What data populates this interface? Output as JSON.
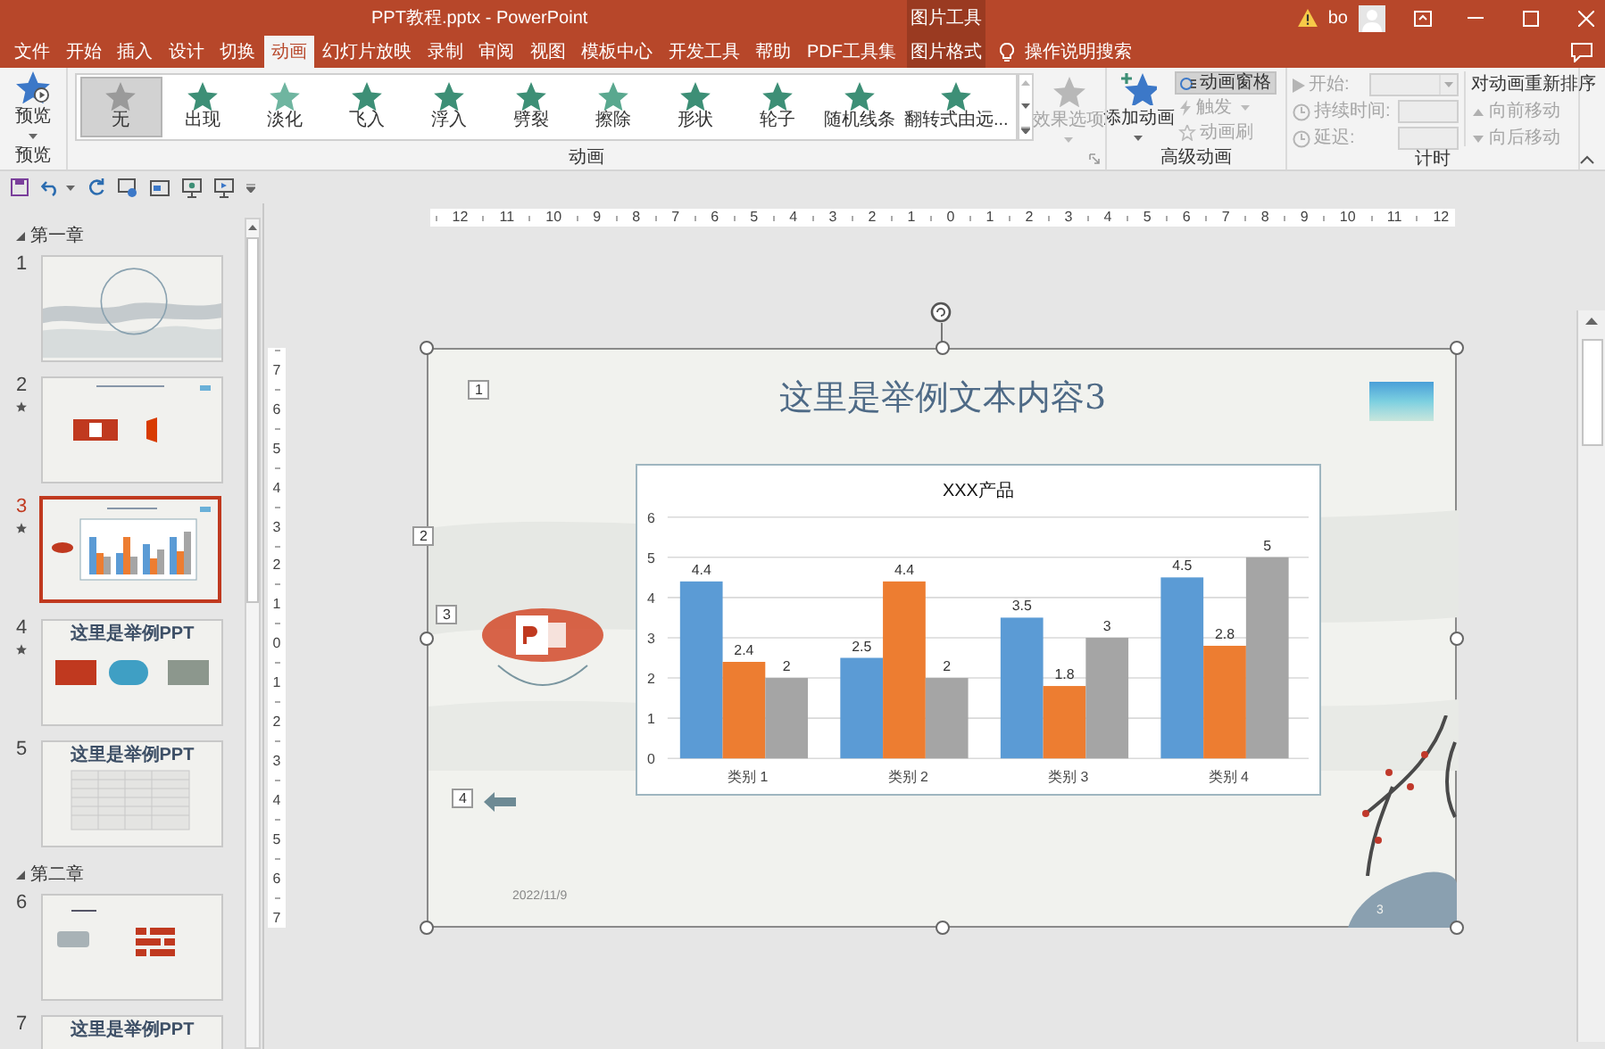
{
  "window": {
    "title": "PPT教程.pptx  -  PowerPoint",
    "context_label": "图片工具",
    "user": "bo"
  },
  "tabs": [
    {
      "label": "文件",
      "selected": false,
      "kind": "plain"
    },
    {
      "label": "开始",
      "selected": false,
      "kind": "plain"
    },
    {
      "label": "插入",
      "selected": false,
      "kind": "plain"
    },
    {
      "label": "设计",
      "selected": false,
      "kind": "plain"
    },
    {
      "label": "切换",
      "selected": false,
      "kind": "plain"
    },
    {
      "label": "动画",
      "selected": true,
      "kind": "plain"
    },
    {
      "label": "幻灯片放映",
      "selected": false,
      "kind": "plain"
    },
    {
      "label": "录制",
      "selected": false,
      "kind": "plain"
    },
    {
      "label": "审阅",
      "selected": false,
      "kind": "plain"
    },
    {
      "label": "视图",
      "selected": false,
      "kind": "plain"
    },
    {
      "label": "模板中心",
      "selected": false,
      "kind": "plain"
    },
    {
      "label": "开发工具",
      "selected": false,
      "kind": "plain"
    },
    {
      "label": "帮助",
      "selected": false,
      "kind": "plain"
    },
    {
      "label": "PDF工具集",
      "selected": false,
      "kind": "plain"
    },
    {
      "label": "图片格式",
      "selected": false,
      "kind": "contextual"
    }
  ],
  "search": {
    "placeholder": "操作说明搜索"
  },
  "ribbon": {
    "preview": {
      "label": "预览",
      "group": "预览"
    },
    "gallery": {
      "group": "动画",
      "items": [
        {
          "label": "无",
          "selected": true
        },
        {
          "label": "出现",
          "selected": false
        },
        {
          "label": "淡化",
          "selected": false
        },
        {
          "label": "飞入",
          "selected": false
        },
        {
          "label": "浮入",
          "selected": false
        },
        {
          "label": "劈裂",
          "selected": false
        },
        {
          "label": "擦除",
          "selected": false
        },
        {
          "label": "形状",
          "selected": false
        },
        {
          "label": "轮子",
          "selected": false
        },
        {
          "label": "随机线条",
          "selected": false
        },
        {
          "label": "翻转式由远...",
          "selected": false
        }
      ]
    },
    "effect_options": {
      "label": "效果选项",
      "disabled": true
    },
    "advanced": {
      "group": "高级动画",
      "add": "添加动画",
      "pane": {
        "label": "动画窗格",
        "on": true
      },
      "trigger": {
        "label": "触发",
        "disabled": true
      },
      "painter": {
        "label": "动画刷",
        "disabled": true
      }
    },
    "timing": {
      "group": "计时",
      "fields": [
        {
          "label": "开始:",
          "kind": "dropdown",
          "disabled": true
        },
        {
          "label": "持续时间:",
          "kind": "spin",
          "disabled": true
        },
        {
          "label": "延迟:",
          "kind": "spin",
          "disabled": true
        }
      ],
      "reorder": {
        "title": "对动画重新排序",
        "buttons": [
          {
            "label": "向前移动",
            "disabled": true
          },
          {
            "label": "向后移动",
            "disabled": true
          }
        ]
      }
    }
  },
  "slides_panel": {
    "sections": [
      {
        "title": "第一章",
        "expanded": true,
        "slides": [
          {
            "number": "1",
            "selected": false,
            "animated": false,
            "kind": "cover"
          },
          {
            "number": "2",
            "selected": false,
            "animated": true,
            "kind": "logos"
          },
          {
            "number": "3",
            "selected": true,
            "animated": true,
            "kind": "chart"
          },
          {
            "number": "4",
            "selected": false,
            "animated": true,
            "kind": "images",
            "title": "这里是举例PPT"
          },
          {
            "number": "5",
            "selected": false,
            "animated": false,
            "kind": "table",
            "title": "这里是举例PPT"
          }
        ]
      },
      {
        "title": "第二章",
        "expanded": true,
        "slides": [
          {
            "number": "6",
            "selected": false,
            "animated": false,
            "kind": "tiles"
          },
          {
            "number": "7",
            "selected": false,
            "animated": false,
            "kind": "title",
            "title": "这里是举例PPT"
          }
        ]
      }
    ]
  },
  "rulers": {
    "horizontal": [
      "12",
      "11",
      "10",
      "9",
      "8",
      "7",
      "6",
      "5",
      "4",
      "3",
      "2",
      "1",
      "0",
      "1",
      "2",
      "3",
      "4",
      "5",
      "6",
      "7",
      "8",
      "9",
      "10",
      "11",
      "12"
    ],
    "vertical": [
      "7",
      "6",
      "5",
      "4",
      "3",
      "2",
      "1",
      "0",
      "1",
      "2",
      "3",
      "4",
      "5",
      "6",
      "7"
    ]
  },
  "slide": {
    "title": "这里是举例文本内容3",
    "tags": [
      "1",
      "2",
      "3",
      "4"
    ],
    "date": "2022/11/9",
    "number": "3",
    "chart_data": {
      "type": "bar",
      "title": "XXX产品",
      "categories": [
        "类别 1",
        "类别 2",
        "类别 3",
        "类别 4"
      ],
      "series": [
        {
          "color": "#5b9bd5",
          "values": [
            4.4,
            2.5,
            3.5,
            4.5
          ]
        },
        {
          "color": "#ed7d31",
          "values": [
            2.4,
            4.4,
            1.8,
            2.8
          ]
        },
        {
          "color": "#a5a5a5",
          "values": [
            2,
            2,
            3,
            5
          ]
        }
      ],
      "ylim": [
        0,
        6
      ],
      "yticks": [
        0,
        1,
        2,
        3,
        4,
        5,
        6
      ],
      "grid": true,
      "data_labels": true
    }
  }
}
